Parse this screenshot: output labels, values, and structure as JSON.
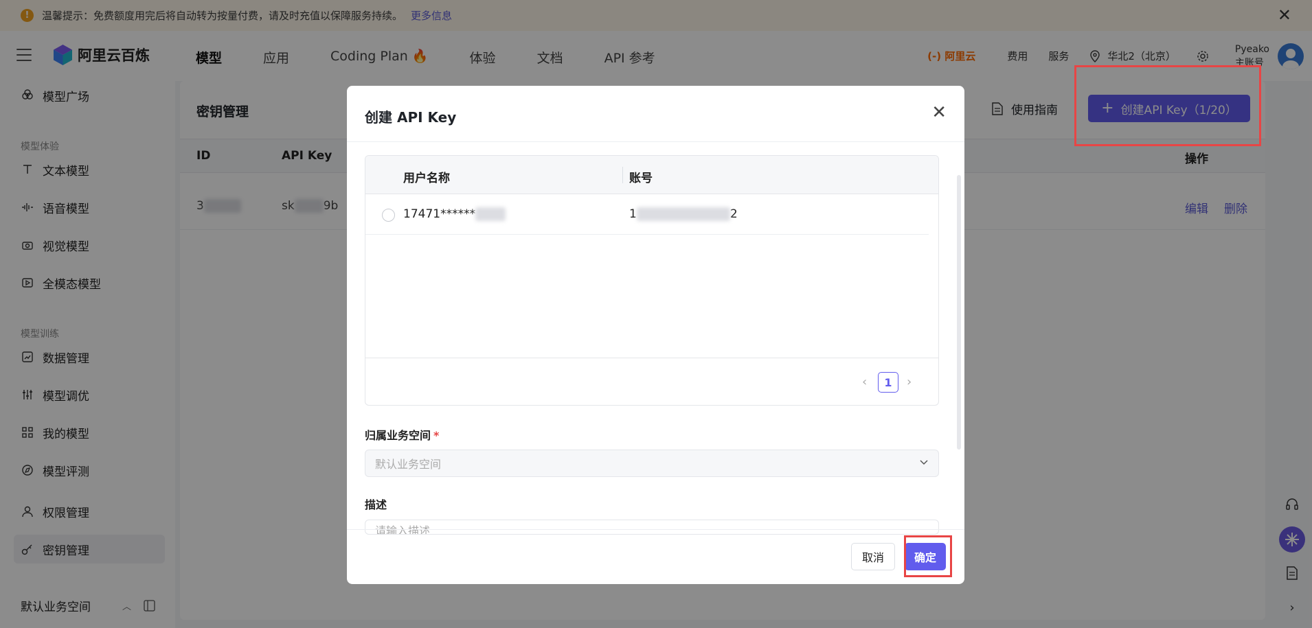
{
  "notice": {
    "text": "温馨提示：免费额度用完后将自动转为按量付费，请及时充值以保障服务持续。",
    "more": "更多信息"
  },
  "header": {
    "brand": "阿里云百炼",
    "nav": [
      "模型",
      "应用",
      "Coding Plan",
      "体验",
      "文档",
      "API 参考"
    ],
    "aliyun": "阿里云",
    "fees": "费用",
    "service": "服务",
    "region": "华北2（北京）",
    "user_name": "Pyeako",
    "user_role": "主账号"
  },
  "sidebar": {
    "items": [
      {
        "label": "模型广场",
        "icon": "model-plaza-icon"
      },
      {
        "label": "文本模型",
        "icon": "text-icon"
      },
      {
        "label": "语音模型",
        "icon": "audio-wave-icon"
      },
      {
        "label": "视觉模型",
        "icon": "camera-icon"
      },
      {
        "label": "全模态模型",
        "icon": "video-icon"
      },
      {
        "label": "数据管理",
        "icon": "chart-icon"
      },
      {
        "label": "模型调优",
        "icon": "sliders-icon"
      },
      {
        "label": "我的模型",
        "icon": "grid-icon"
      },
      {
        "label": "模型评测",
        "icon": "compass-icon"
      },
      {
        "label": "权限管理",
        "icon": "user-icon"
      },
      {
        "label": "密钥管理",
        "icon": "key-icon"
      }
    ],
    "group_experience": "模型体验",
    "group_training": "模型训练",
    "workspace": "默认业务空间"
  },
  "content": {
    "title": "密钥管理",
    "guide": "使用指南",
    "create_button": "创建API Key（1/20）",
    "columns": {
      "id": "ID",
      "api_key": "API Key",
      "ops": "操作"
    },
    "row": {
      "id": "3",
      "api_key_prefix": "sk",
      "api_key_suffix": "9b",
      "edit": "编辑",
      "delete": "删除"
    }
  },
  "modal": {
    "title": "创建 API Key",
    "table": {
      "col_user": "用户名称",
      "col_account": "账号",
      "rows": [
        {
          "user": "17471******",
          "account_prefix": "1",
          "account_suffix": "2"
        }
      ],
      "page": "1"
    },
    "workspace_label": "归属业务空间",
    "required_mark": "*",
    "workspace_placeholder": "默认业务空间",
    "desc_label": "描述",
    "desc_placeholder": "请输入描述",
    "cancel": "取消",
    "confirm": "确定"
  },
  "colors": {
    "accent": "#615ced",
    "highlight": "#e84545",
    "warning": "#f0a020",
    "aliyun": "#ff6a00"
  }
}
